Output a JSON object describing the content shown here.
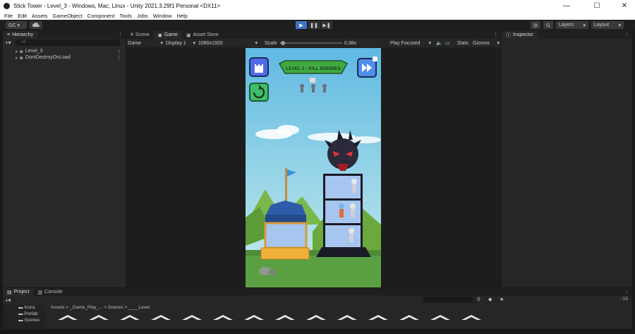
{
  "window": {
    "title": "Stick Tower - Level_3 - Windows, Mac, Linux - Unity 2021.3.29f1 Personal <DX11>",
    "min_glyph": "—",
    "max_glyph": "☐",
    "close_glyph": "✕"
  },
  "menu": [
    "File",
    "Edit",
    "Assets",
    "GameObject",
    "Component",
    "Tools",
    "Jobs",
    "Window",
    "Help"
  ],
  "toolbar": {
    "account_label": "GC ▾",
    "layers_label": "Layers",
    "layout_label": "Layout",
    "play_glyph": "▶",
    "pause_glyph": "❚❚",
    "step_glyph": "▶❚"
  },
  "hierarchy": {
    "tab_label": "Hierarchy",
    "search_placeholder": "All",
    "items": [
      "Level_3",
      "DontDestroyOnLoad"
    ]
  },
  "center_tabs": {
    "scene": "Scene",
    "game": "Game",
    "asset_store": "Asset Store"
  },
  "game_toolbar": {
    "display_mode": "Game",
    "display": "Display 1",
    "resolution": "1080x1920",
    "scale_label": "Scale",
    "scale_value": "0.38x",
    "play_focused": "Play Focused",
    "stats": "Stats",
    "gizmos": "Gizmos"
  },
  "inspector": {
    "tab_label": "Inspector"
  },
  "bottom": {
    "project_tab": "Project",
    "console_tab": "Console",
    "breadcrumb": "Assets > _Game_Play_... > Scenes > ____Level",
    "folders": [
      "Icons",
      "Prefab",
      "Scenes"
    ],
    "zoom_count": "15"
  },
  "game": {
    "level_banner": "LEVEL 3 - KILL ENEMIES",
    "colors": {
      "sky_top": "#5fb9e2",
      "sky_bottom": "#c8ecec",
      "button_fill": "#4f6ae8",
      "restart_fill": "#3fbf6a",
      "banner_fill": "#3faa3f",
      "ground": "#5aa043"
    }
  },
  "colors": {
    "play_active": "#3a76c7",
    "editor_bg": "#191919",
    "panel_bg": "#282828"
  }
}
